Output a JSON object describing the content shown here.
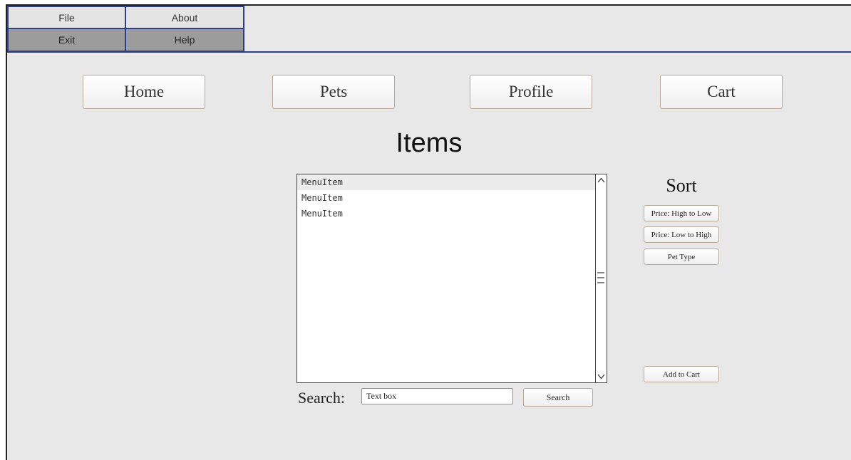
{
  "menu": {
    "top": [
      "File",
      "About"
    ],
    "bottom": [
      "Exit",
      "Help"
    ]
  },
  "nav": {
    "home": "Home",
    "pets": "Pets",
    "profile": "Profile",
    "cart": "Cart"
  },
  "page": {
    "title": "Items"
  },
  "list": {
    "items": [
      "MenuItem",
      "MenuItem",
      "MenuItem"
    ],
    "selected_index": 0
  },
  "search": {
    "label": "Search:",
    "value": "Text box",
    "button": "Search"
  },
  "sort": {
    "title": "Sort",
    "high_to_low": "Price: High to Low",
    "low_to_high": "Price: Low to High",
    "pet_type": "Pet Type"
  },
  "actions": {
    "add_to_cart": "Add to Cart"
  },
  "icons": {
    "scroll_up": "chevron-up-icon",
    "scroll_down": "chevron-down-icon",
    "scroll_thumb": "grip-icon"
  },
  "colors": {
    "menu_border": "#2b3f8c",
    "menu_secondary_bg": "#9c9c9c",
    "window_bg": "#e8e8e8"
  }
}
